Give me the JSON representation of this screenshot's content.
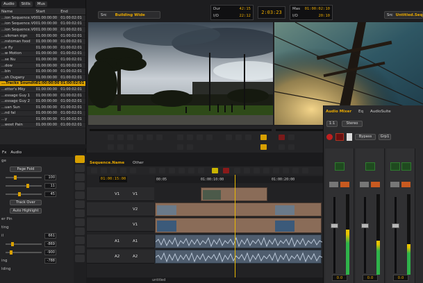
{
  "bin": {
    "tabs": [
      "Audio",
      "Stills",
      "Mus"
    ],
    "columns": [
      "Name",
      "Start",
      "End"
    ],
    "rows": [
      {
        "name": "...ion Sequence.V0.2",
        "start": "01:00:00:00",
        "end": "01:00:02:01"
      },
      {
        "name": "...ion Sequence.V0.3",
        "start": "01:00:00:00",
        "end": "01:00:02:01"
      },
      {
        "name": "...ion Sequence.V0.1",
        "start": "01:00:00:00",
        "end": "01:00:02:01"
      },
      {
        "name": "...ulkman sign",
        "start": "01:00:00:00",
        "end": "01:00:02:01"
      },
      {
        "name": "...nstoman food",
        "start": "01:00:00:00",
        "end": "01:00:02:01"
      },
      {
        "name": "...e fly",
        "start": "01:00:00:00",
        "end": "01:00:02:01"
      },
      {
        "name": "...w Motion",
        "start": "01:00:00:00",
        "end": "01:00:02:01"
      },
      {
        "name": "...se Nu",
        "start": "01:00:00:00",
        "end": "01:00:02:01"
      },
      {
        "name": "...dow",
        "start": "01:00:00:00",
        "end": "01:00:02:01"
      },
      {
        "name": "...bin",
        "start": "01:00:00:00",
        "end": "01:00:02:01"
      },
      {
        "name": "...sh Dugany",
        "start": "01:00:00:00",
        "end": "01:00:02:01"
      },
      {
        "name": "...Tracks Soundtrack",
        "start": "01:00:00:00",
        "end": "01:00:02:01",
        "selected": true
      },
      {
        "name": "...etter's Mky",
        "start": "01:00:00:00",
        "end": "01:00:02:01"
      },
      {
        "name": "...essage Guy 1",
        "start": "01:00:00:00",
        "end": "01:00:02:01"
      },
      {
        "name": "...essage Guy 2",
        "start": "01:00:00:00",
        "end": "01:00:02:01"
      },
      {
        "name": "...uan Sun",
        "start": "01:00:00:00",
        "end": "01:00:02:01"
      },
      {
        "name": "...nd fal",
        "start": "01:00:00:00",
        "end": "01:00:02:01"
      },
      {
        "name": "...y",
        "start": "01:00:00:00",
        "end": "01:00:02:01"
      },
      {
        "name": "...weet Pain",
        "start": "01:00:00:00",
        "end": "01:00:02:01"
      }
    ]
  },
  "effect": {
    "tabs": [
      "Fx",
      "Audio"
    ],
    "labels": [
      "ge",
      "ting",
      "er Pin",
      "ing",
      "il",
      "lding"
    ],
    "page_fold": "Page Fold",
    "track_over": "Track Over",
    "auto_highlight": "Auto Highlight",
    "values": [
      "100",
      "11",
      "45",
      "661",
      "-869",
      "-900",
      "-788"
    ]
  },
  "composer": {
    "src_label": "Src",
    "src_value": "Building Wide",
    "rec_label": "Src",
    "rec_value": "Untitled.Seq",
    "tc_left": [
      {
        "k": "Dur",
        "v": "42:15"
      },
      {
        "k": "I/O",
        "v": "22:12"
      }
    ],
    "center_tc": "2:03:23",
    "tc_right": [
      {
        "k": "Mas",
        "v": "01:00:02:10"
      },
      {
        "k": "I/O",
        "v": "20:10"
      }
    ]
  },
  "timeline": {
    "tabs": [
      "Sequence.Name",
      "Other"
    ],
    "current_tc": "01:00:15:00",
    "ruler": [
      "00:05",
      "01:00:10:00",
      "01:00:20:00"
    ],
    "tracks": [
      "V1",
      "V2",
      "V1",
      "A1",
      "A2"
    ],
    "src_tracks": [
      "V1",
      "A1",
      "A2"
    ],
    "footer": "untitled"
  },
  "mixer": {
    "tabs": [
      "Audio Mixer",
      "Eq",
      "AudioSuite"
    ],
    "mode": "Stereo",
    "group": "Grp1",
    "bypass": "Bypass",
    "channel_label": "1:1",
    "levels": [
      "0.0",
      "0.0",
      "0.0"
    ],
    "meter_levels": [
      0.56,
      0.42,
      0.38
    ],
    "accent": "#e9a900",
    "meter_color": "#2fb34a"
  }
}
